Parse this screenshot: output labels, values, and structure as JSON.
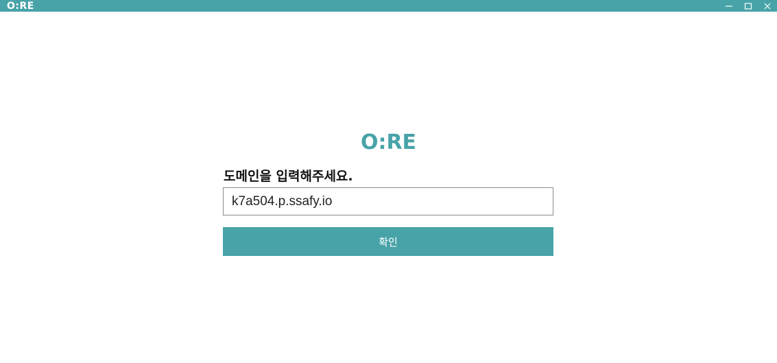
{
  "window": {
    "title": "O:RE",
    "controls": {
      "minimize": "minimize-icon",
      "maximize": "maximize-icon",
      "close": "close-icon"
    }
  },
  "main": {
    "logo": "O:RE",
    "prompt": "도메인을 입력해주세요.",
    "domain_value": "k7a504.p.ssafy.io",
    "confirm_label": "확인"
  },
  "colors": {
    "accent": "#48a3a8",
    "background": "#ffffff"
  }
}
